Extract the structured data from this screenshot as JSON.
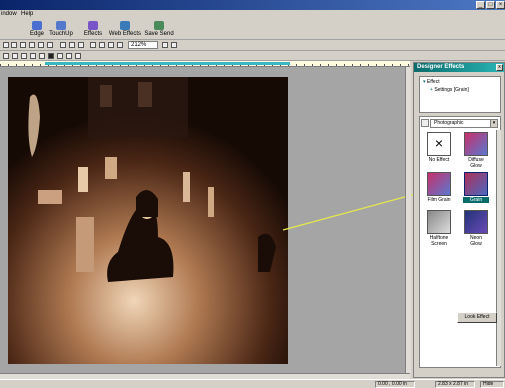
{
  "menu": {
    "items": [
      "indow",
      "Help"
    ]
  },
  "toolbar": {
    "buttons": [
      {
        "label": "Edge",
        "icon": "edge-icon",
        "color": "#4a6fd0"
      },
      {
        "label": "TouchUp",
        "icon": "touchup-icon",
        "color": "#5577cc"
      },
      {
        "label": "Effects",
        "icon": "effects-icon",
        "color": "#7a55c8"
      },
      {
        "label": "Web Effects",
        "icon": "web-effects-icon",
        "color": "#3a7ab8"
      },
      {
        "label": "Save Send",
        "icon": "save-send-icon",
        "color": "#4b8a5a"
      }
    ],
    "zoom": "212%"
  },
  "designer_panel": {
    "title": "Designer Effects",
    "close": "x",
    "tree": {
      "root": "Effect",
      "child": "Settings [Grain]"
    },
    "category": "Photographic",
    "effects": [
      {
        "label1": "No Effect",
        "label2": "",
        "icon": "no-effect-icon"
      },
      {
        "label1": "Diffuse",
        "label2": "Glow",
        "icon": "diffuse-glow-icon"
      },
      {
        "label1": "Film Grain",
        "label2": "",
        "icon": "film-grain-icon"
      },
      {
        "label1": "Grain",
        "label2": "",
        "icon": "grain-icon"
      },
      {
        "label1": "Halftone",
        "label2": "Screen",
        "icon": "halftone-screen-icon"
      },
      {
        "label1": "Neon",
        "label2": "Glow",
        "icon": "neon-glow-icon"
      }
    ],
    "button": "Look Effect"
  },
  "status": {
    "coords": "0.00 , 0.00 in",
    "size": "2.83 x 2.87 in",
    "view": "Hide"
  },
  "colors": {
    "accent": "#0a246a",
    "panel_title": "#0a6b6b",
    "callout": "#e8e84a"
  }
}
